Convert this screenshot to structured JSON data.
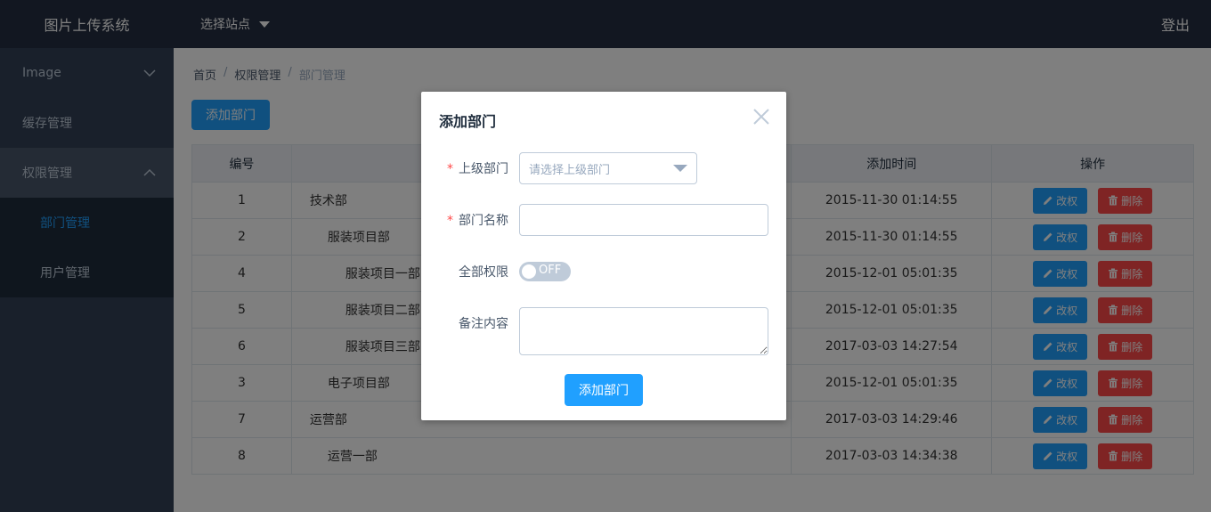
{
  "app": {
    "title": "图片上传系统"
  },
  "header": {
    "site_select": "选择站点",
    "logout": "登出"
  },
  "sidebar": {
    "items": [
      {
        "label": "Image"
      },
      {
        "label": "缓存管理"
      },
      {
        "label": "权限管理"
      }
    ],
    "subitems": [
      {
        "label": "部门管理"
      },
      {
        "label": "用户管理"
      }
    ]
  },
  "breadcrumb": {
    "home": "首页",
    "level1": "权限管理",
    "current": "部门管理",
    "sep": "/"
  },
  "toolbar": {
    "add_label": "添加部门"
  },
  "table": {
    "headers": [
      "编号",
      "",
      "添加时间",
      "操作"
    ],
    "edit_label": "改权",
    "delete_label": "删除",
    "rows": [
      {
        "id": "1",
        "name": "技术部",
        "level": 0,
        "time": "2015-11-30 01:14:55"
      },
      {
        "id": "2",
        "name": "服装项目部",
        "level": 1,
        "time": "2015-11-30 01:14:55"
      },
      {
        "id": "4",
        "name": "服装项目一部",
        "level": 2,
        "time": "2015-12-01 05:01:35"
      },
      {
        "id": "5",
        "name": "服装项目二部",
        "level": 2,
        "time": "2015-12-01 05:01:35"
      },
      {
        "id": "6",
        "name": "服装项目三部",
        "level": 2,
        "time": "2017-03-03 14:27:54"
      },
      {
        "id": "3",
        "name": "电子项目部",
        "level": 1,
        "time": "2015-12-01 05:01:35"
      },
      {
        "id": "7",
        "name": "运营部",
        "level": 0,
        "time": "2017-03-03 14:29:46"
      },
      {
        "id": "8",
        "name": "运营一部",
        "level": 1,
        "time": "2017-03-03 14:34:38"
      }
    ]
  },
  "dialog": {
    "title": "添加部门",
    "required_mark": "*",
    "parent_label": "上级部门",
    "parent_placeholder": "请选择上级部门",
    "name_label": "部门名称",
    "name_value": "",
    "all_perm_label": "全部权限",
    "switch_text": "OFF",
    "note_label": "备注内容",
    "note_value": "",
    "submit_label": "添加部门"
  },
  "colors": {
    "primary": "#20a0ff",
    "danger": "#ff4949",
    "sidebar": "#324157",
    "header": "#242f42"
  }
}
